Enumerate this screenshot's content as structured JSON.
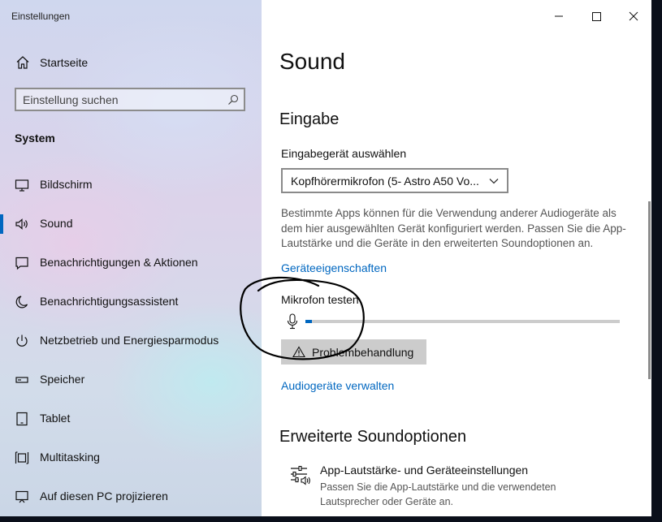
{
  "window": {
    "title": "Einstellungen"
  },
  "sidebar": {
    "home_label": "Startseite",
    "search_placeholder": "Einstellung suchen",
    "section": "System",
    "items": [
      {
        "label": "Bildschirm",
        "icon": "monitor-icon"
      },
      {
        "label": "Sound",
        "icon": "speaker-icon",
        "selected": true
      },
      {
        "label": "Benachrichtigungen & Aktionen",
        "icon": "notification-icon"
      },
      {
        "label": "Benachrichtigungsassistent",
        "icon": "moon-icon"
      },
      {
        "label": "Netzbetrieb und Energiesparmodus",
        "icon": "power-icon"
      },
      {
        "label": "Speicher",
        "icon": "storage-icon"
      },
      {
        "label": "Tablet",
        "icon": "tablet-icon"
      },
      {
        "label": "Multitasking",
        "icon": "multitasking-icon"
      },
      {
        "label": "Auf diesen PC projizieren",
        "icon": "project-icon"
      }
    ]
  },
  "main": {
    "title": "Sound",
    "input_heading": "Eingabe",
    "device_label": "Eingabegerät auswählen",
    "device_value": "Kopfhörermikrofon (5- Astro A50 Vo...",
    "description": "Bestimmte Apps können für die Verwendung anderer Audiogeräte als dem hier ausgewählten Gerät konfiguriert werden. Passen Sie die App-Lautstärke und die Geräte in den erweiterten Soundoptionen an.",
    "device_properties_link": "Geräteeigenschaften",
    "test_mic_label": "Mikrofon testen",
    "mic_level_percent": 2,
    "troubleshoot_label": "Problembehandlung",
    "manage_devices_link": "Audiogeräte verwalten",
    "advanced_heading": "Erweiterte Soundoptionen",
    "app_volume_title": "App-Lautstärke- und Geräteeinstellungen",
    "app_volume_desc": "Passen Sie die App-Lautstärke und die verwendeten Lautsprecher oder Geräte an."
  },
  "colors": {
    "accent": "#0067c0",
    "link": "#0067c0",
    "annotation": "#000000"
  }
}
